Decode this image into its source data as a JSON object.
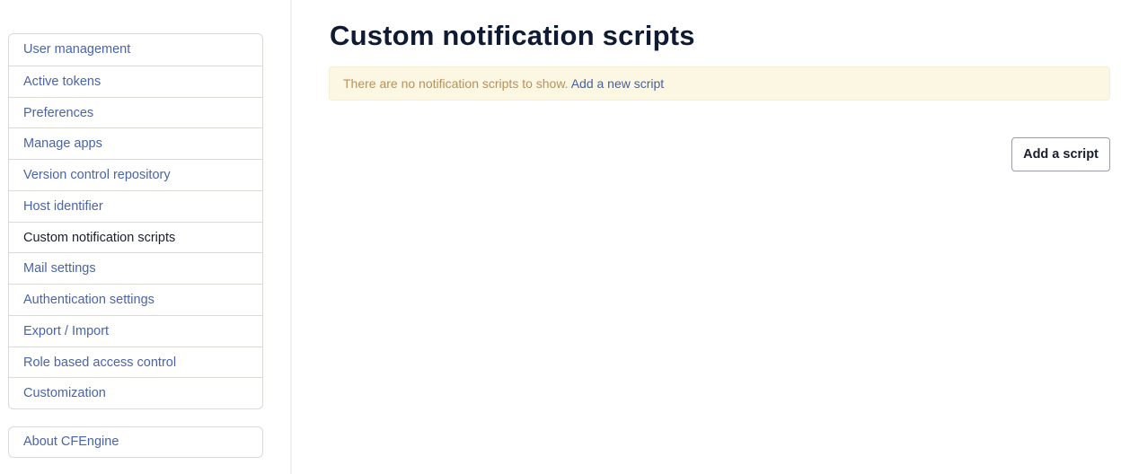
{
  "sidebar": {
    "items": [
      {
        "label": "User management",
        "active": false
      },
      {
        "label": "Active tokens",
        "active": false
      },
      {
        "label": "Preferences",
        "active": false
      },
      {
        "label": "Manage apps",
        "active": false
      },
      {
        "label": "Version control repository",
        "active": false
      },
      {
        "label": "Host identifier",
        "active": false
      },
      {
        "label": "Custom notification scripts",
        "active": true
      },
      {
        "label": "Mail settings",
        "active": false
      },
      {
        "label": "Authentication settings",
        "active": false
      },
      {
        "label": "Export / Import",
        "active": false
      },
      {
        "label": "Role based access control",
        "active": false
      },
      {
        "label": "Customization",
        "active": false
      }
    ],
    "about": {
      "label": "About CFEngine"
    }
  },
  "main": {
    "title": "Custom notification scripts",
    "alert": {
      "message": "There are no notification scripts to show.",
      "link_label": "Add a new script"
    },
    "add_button_label": "Add a script"
  },
  "colors": {
    "link": "#4a64a8",
    "active_text": "#1a1f2e",
    "title": "#0f1a33",
    "alert_bg": "#fcf7e2",
    "alert_text": "#b8915a"
  }
}
